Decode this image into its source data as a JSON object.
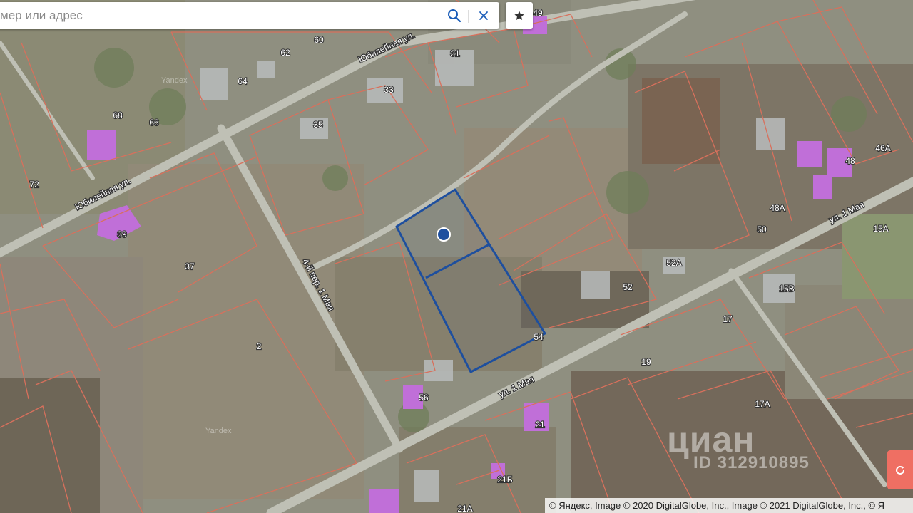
{
  "search": {
    "placeholder": "мер или адрес"
  },
  "map": {
    "plot_color": "#1e4f9e",
    "boundary_color": "#d8705c",
    "building_color": "#c06fd8",
    "streets": [
      {
        "id": "street-yubileynaya-upper",
        "label": "Юбилейная ул."
      },
      {
        "id": "street-yubileynaya-lower",
        "label": "Юбилейная ул."
      },
      {
        "id": "street-4th-lane",
        "label": "4-й пер. 1 Мая"
      },
      {
        "id": "street-1-maya-lower",
        "label": "ул. 1 Мая"
      },
      {
        "id": "street-1-maya-upper",
        "label": "ул. 1 Мая"
      }
    ],
    "house_numbers": [
      "60",
      "62",
      "64",
      "68",
      "66",
      "72",
      "39",
      "37",
      "2",
      "35",
      "33",
      "31",
      "49",
      "48",
      "46А",
      "48А",
      "50",
      "52А",
      "52",
      "54",
      "56",
      "17",
      "15В",
      "15А",
      "19",
      "17А",
      "21",
      "21Б",
      "21А"
    ],
    "provider_marks": [
      "Yandex",
      "Yandex"
    ]
  },
  "watermark": {
    "logo": "циан",
    "id": "ID 312910895"
  },
  "attribution": "© Яндекс, Image © 2020 DigitalGlobe, Inc., Image © 2021 DigitalGlobe, Inc., © Я"
}
